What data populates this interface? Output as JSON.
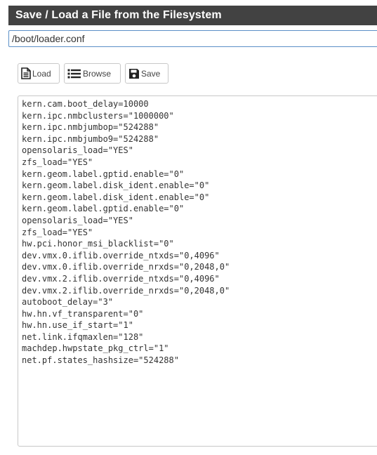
{
  "panel": {
    "title": "Save / Load a File from the Filesystem"
  },
  "path_input": {
    "value": "/boot/loader.conf"
  },
  "toolbar": {
    "load_label": "Load",
    "browse_label": "Browse",
    "save_label": "Save",
    "icons": {
      "load": "file-icon",
      "browse": "list-icon",
      "save": "floppy-disk-icon"
    }
  },
  "editor": {
    "lines": [
      "kern.cam.boot_delay=10000",
      "kern.ipc.nmbclusters=\"1000000\"",
      "kern.ipc.nmbjumbop=\"524288\"",
      "kern.ipc.nmbjumbo9=\"524288\"",
      "opensolaris_load=\"YES\"",
      "zfs_load=\"YES\"",
      "kern.geom.label.gptid.enable=\"0\"",
      "kern.geom.label.disk_ident.enable=\"0\"",
      "kern.geom.label.disk_ident.enable=\"0\"",
      "kern.geom.label.gptid.enable=\"0\"",
      "opensolaris_load=\"YES\"",
      "zfs_load=\"YES\"",
      "hw.pci.honor_msi_blacklist=\"0\"",
      "dev.vmx.0.iflib.override_ntxds=\"0,4096\"",
      "dev.vmx.0.iflib.override_nrxds=\"0,2048,0\"",
      "dev.vmx.2.iflib.override_ntxds=\"0,4096\"",
      "dev.vmx.2.iflib.override_nrxds=\"0,2048,0\"",
      "autoboot_delay=\"3\"",
      "hw.hn.vf_transparent=\"0\"",
      "hw.hn.use_if_start=\"1\"",
      "net.link.ifqmaxlen=\"128\"",
      "machdep.hwpstate_pkg_ctrl=\"1\"",
      "net.pf.states_hashsize=\"524288\""
    ]
  },
  "colors": {
    "header_bg": "#424242",
    "header_text": "#ffffff",
    "input_border": "#5b8fc7",
    "button_border": "#c8c8c8"
  }
}
